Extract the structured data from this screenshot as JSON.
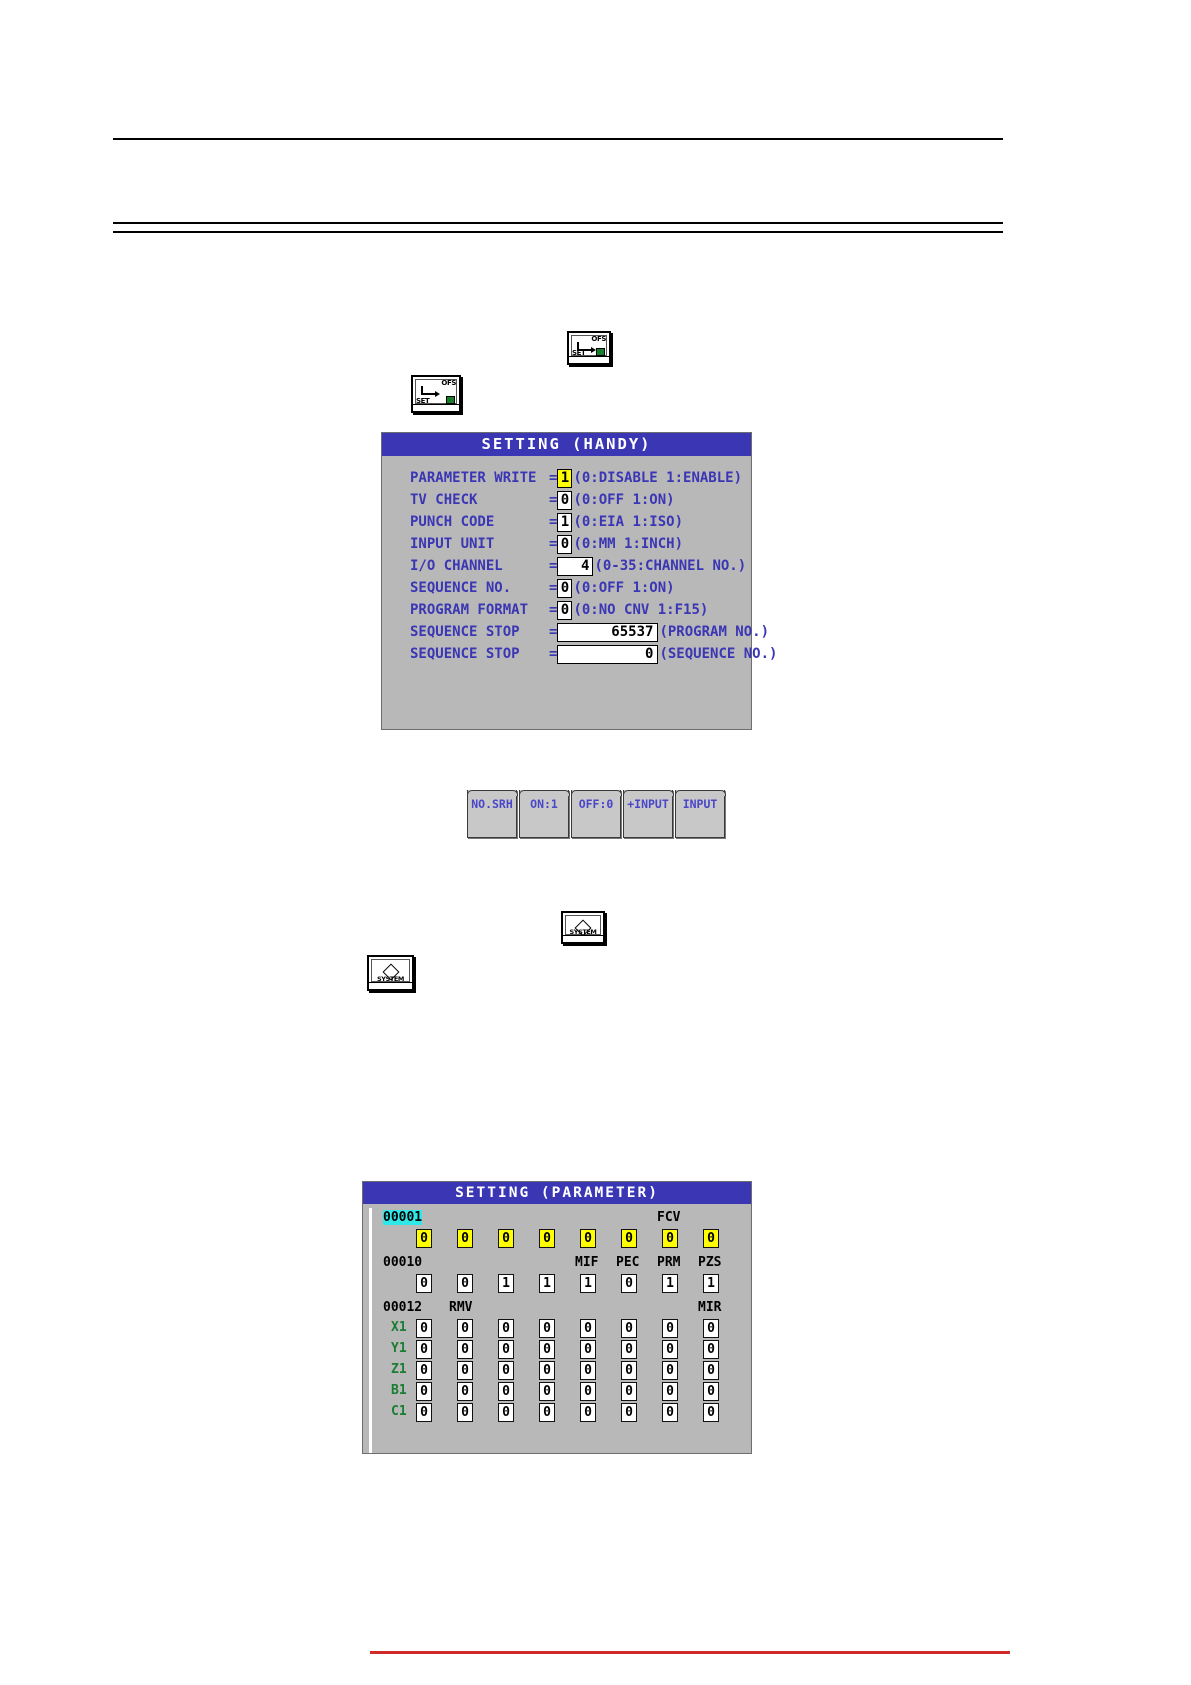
{
  "page": {
    "rules": [
      "top-thin-rule",
      "header-thick-rule"
    ]
  },
  "keys": {
    "ofs_set": {
      "top_label": "OFS",
      "bottom_label": "SET",
      "name": "offset-setting-key"
    },
    "system": {
      "label": "SYSTEM",
      "name": "system-key"
    }
  },
  "handy_screen": {
    "title": "SETTING (HANDY)",
    "rows": [
      {
        "label": "PARAMETER WRITE",
        "eq": "=",
        "value": "1",
        "highlight": true,
        "box": "val-1",
        "options": "(0:DISABLE 1:ENABLE)"
      },
      {
        "label": "TV CHECK",
        "eq": "=",
        "value": "0",
        "highlight": false,
        "box": "val-1",
        "options": "(0:OFF     1:ON)"
      },
      {
        "label": "PUNCH CODE",
        "eq": "=",
        "value": "1",
        "highlight": false,
        "box": "val-1",
        "options": "(0:EIA     1:ISO)"
      },
      {
        "label": "INPUT UNIT",
        "eq": "=",
        "value": "0",
        "highlight": false,
        "box": "val-1",
        "options": "(0:MM      1:INCH)"
      },
      {
        "label": "I/O CHANNEL",
        "eq": "=",
        "value": "4",
        "highlight": false,
        "box": "val-3",
        "options": "(0-35:CHANNEL NO.)"
      },
      {
        "label": "SEQUENCE NO.",
        "eq": "=",
        "value": "0",
        "highlight": false,
        "box": "val-1",
        "options": "(0:OFF     1:ON)"
      },
      {
        "label": "PROGRAM FORMAT",
        "eq": "=",
        "value": "0",
        "highlight": false,
        "box": "val-1",
        "options": "(0:NO CNV  1:F15)"
      },
      {
        "label": "SEQUENCE STOP",
        "eq": "=",
        "value": "65537",
        "highlight": false,
        "box": "val-wide",
        "options": "(PROGRAM NO.)"
      },
      {
        "label": "SEQUENCE STOP",
        "eq": "=",
        "value": "0",
        "highlight": false,
        "box": "val-wide",
        "options": "(SEQUENCE NO.)"
      }
    ]
  },
  "softkeys": [
    {
      "label": "NO.SRH",
      "name": "softkey-no-srh"
    },
    {
      "label": "ON:1",
      "name": "softkey-on-1"
    },
    {
      "label": "OFF:0",
      "name": "softkey-off-0"
    },
    {
      "label": "+INPUT",
      "name": "softkey-plus-input"
    },
    {
      "label": "INPUT",
      "name": "softkey-input"
    }
  ],
  "param_screen": {
    "title": "SETTING (PARAMETER)",
    "groups": [
      {
        "number": "00001",
        "number_highlight": true,
        "mnemonics": [
          {
            "text": "FCV",
            "col": 6
          }
        ],
        "bits": [
          "0",
          "0",
          "0",
          "0",
          "0",
          "0",
          "0",
          "0"
        ],
        "bits_highlight": true
      },
      {
        "number": "00010",
        "number_highlight": false,
        "mnemonics": [
          {
            "text": "MIF",
            "col": 4
          },
          {
            "text": "PEC",
            "col": 5
          },
          {
            "text": "PRM",
            "col": 6
          },
          {
            "text": "PZS",
            "col": 7
          }
        ],
        "bits": [
          "0",
          "0",
          "1",
          "1",
          "1",
          "0",
          "1",
          "1"
        ],
        "bits_highlight": false
      },
      {
        "number": "00012",
        "number_highlight": false,
        "left_mnemonic": "RMV",
        "mnemonics": [
          {
            "text": "MIR",
            "col": 7
          }
        ],
        "axes": [
          {
            "label": "X1",
            "bits": [
              "0",
              "0",
              "0",
              "0",
              "0",
              "0",
              "0",
              "0"
            ]
          },
          {
            "label": "Y1",
            "bits": [
              "0",
              "0",
              "0",
              "0",
              "0",
              "0",
              "0",
              "0"
            ]
          },
          {
            "label": "Z1",
            "bits": [
              "0",
              "0",
              "0",
              "0",
              "0",
              "0",
              "0",
              "0"
            ]
          },
          {
            "label": "B1",
            "bits": [
              "0",
              "0",
              "0",
              "0",
              "0",
              "0",
              "0",
              "0"
            ]
          },
          {
            "label": "C1",
            "bits": [
              "0",
              "0",
              "0",
              "0",
              "0",
              "0",
              "0",
              "0"
            ]
          }
        ]
      }
    ]
  },
  "colors": {
    "screen_bg": "#b8b8b8",
    "title_bar": "#3a36b4",
    "text_blue": "#3a36b4",
    "highlight_yellow": "#ffff00",
    "cyan": "#2fe9e9",
    "axis_green": "#1a7d32",
    "softkey_text": "#4a46c8"
  }
}
